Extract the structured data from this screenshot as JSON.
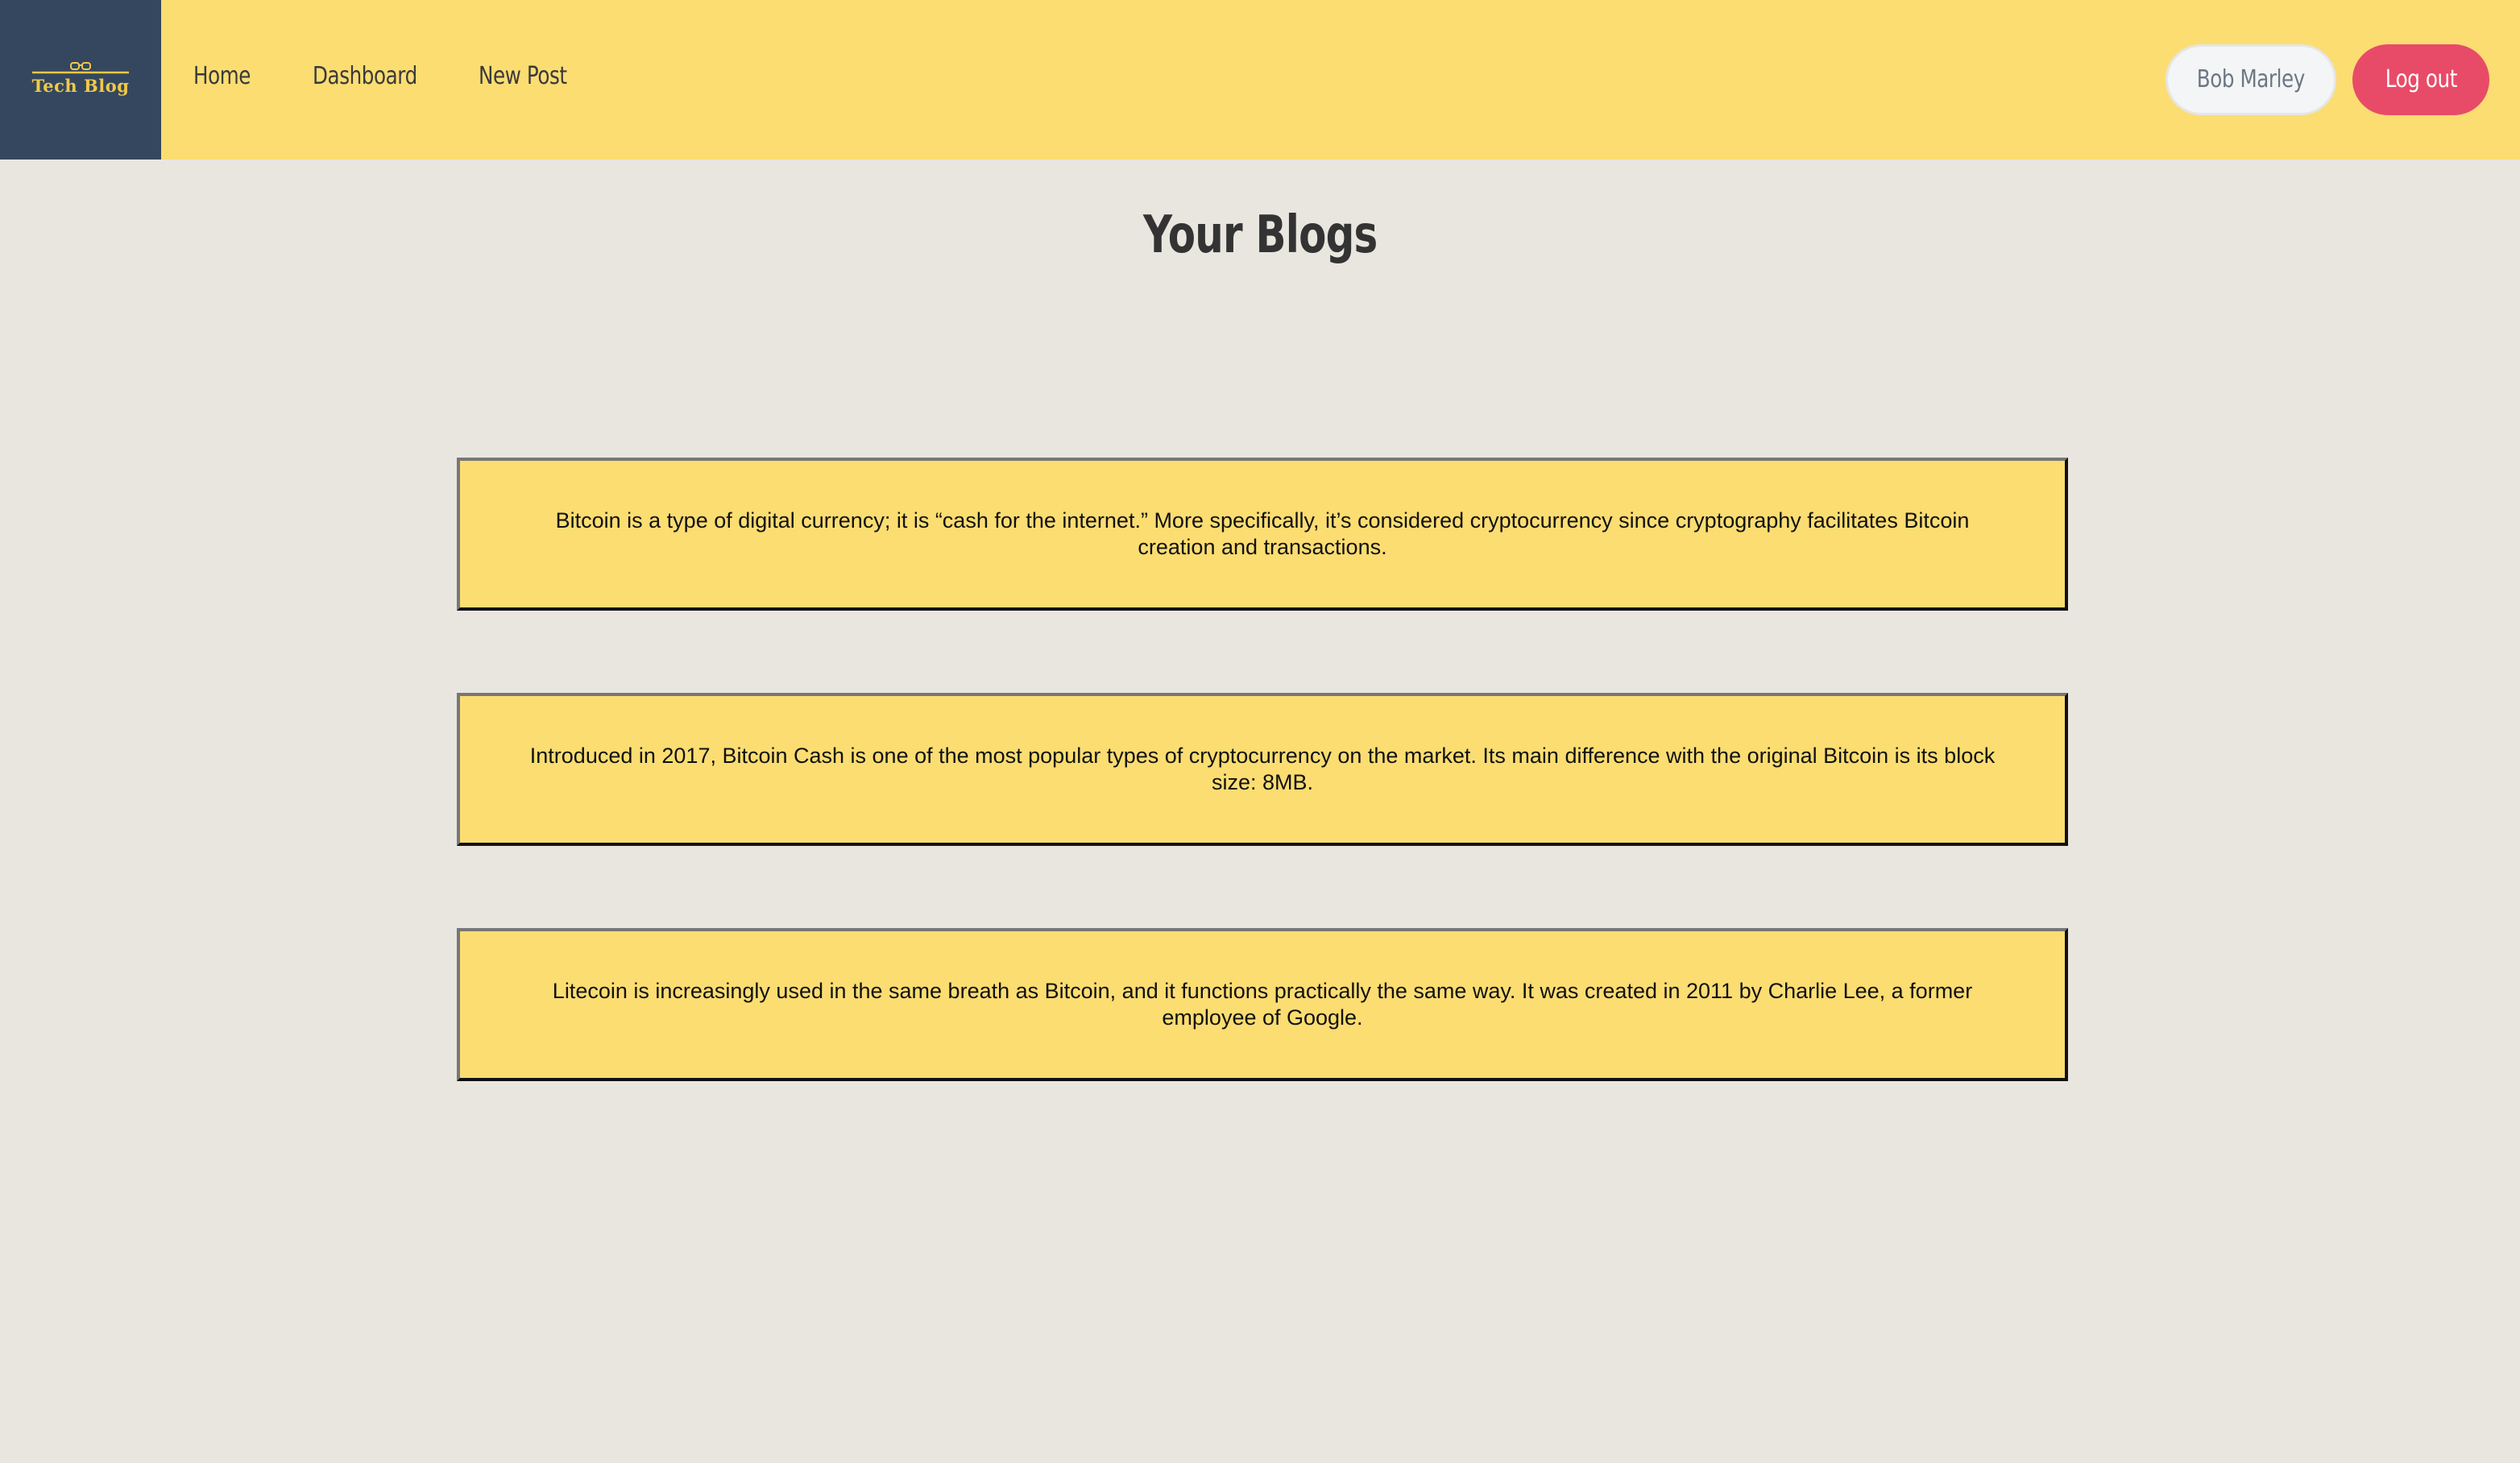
{
  "header": {
    "logo_text": "Tech Blog",
    "logo_icon": "glasses-icon",
    "nav": [
      {
        "label": "Home"
      },
      {
        "label": "Dashboard"
      },
      {
        "label": "New Post"
      }
    ],
    "user_label": "Bob Marley",
    "logout_label": "Log out"
  },
  "main": {
    "title": "Your Blogs",
    "posts": [
      {
        "text": "Bitcoin is a type of digital currency; it is “cash for the internet.” More specifically, it’s considered cryptocurrency since cryptography facilitates Bitcoin creation and transactions."
      },
      {
        "text": "Introduced in 2017, Bitcoin Cash is one of the most popular types of cryptocurrency on the market. Its main difference with the original Bitcoin is its block size: 8MB."
      },
      {
        "text": "Litecoin is increasingly used in the same breath as Bitcoin, and it functions practically the same way. It was created in 2011 by Charlie Lee, a former employee of Google."
      }
    ]
  },
  "colors": {
    "header_bg": "#fbdd72",
    "logo_bg": "#35475e",
    "logo_accent": "#f0c84a",
    "page_bg": "#e9e6df",
    "logout_bg": "#e84b68",
    "user_pill_bg": "#f4f5f6",
    "card_bg": "#fbdd72"
  }
}
